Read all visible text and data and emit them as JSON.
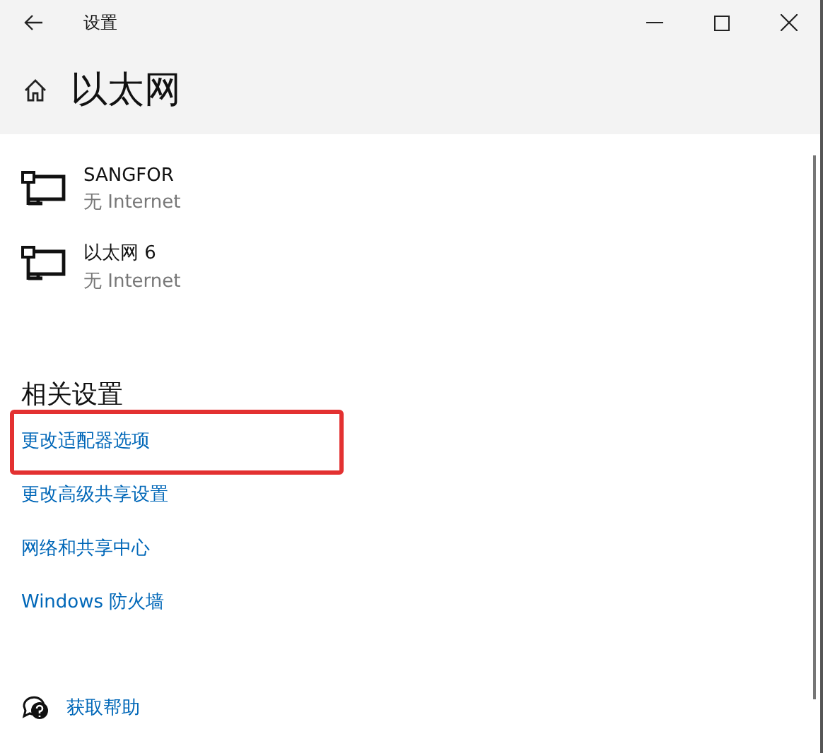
{
  "window": {
    "title": "设置"
  },
  "page": {
    "title": "以太网"
  },
  "adapters": [
    {
      "name": "SANGFOR",
      "status": "无 Internet"
    },
    {
      "name": "以太网 6",
      "status": "无 Internet"
    }
  ],
  "related_settings": {
    "heading": "相关设置",
    "links": [
      {
        "label": "更改适配器选项",
        "highlighted": true
      },
      {
        "label": "更改高级共享设置",
        "highlighted": false
      },
      {
        "label": "网络和共享中心",
        "highlighted": false
      },
      {
        "label": "Windows 防火墙",
        "highlighted": false
      }
    ]
  },
  "help": {
    "label": "获取帮助"
  }
}
